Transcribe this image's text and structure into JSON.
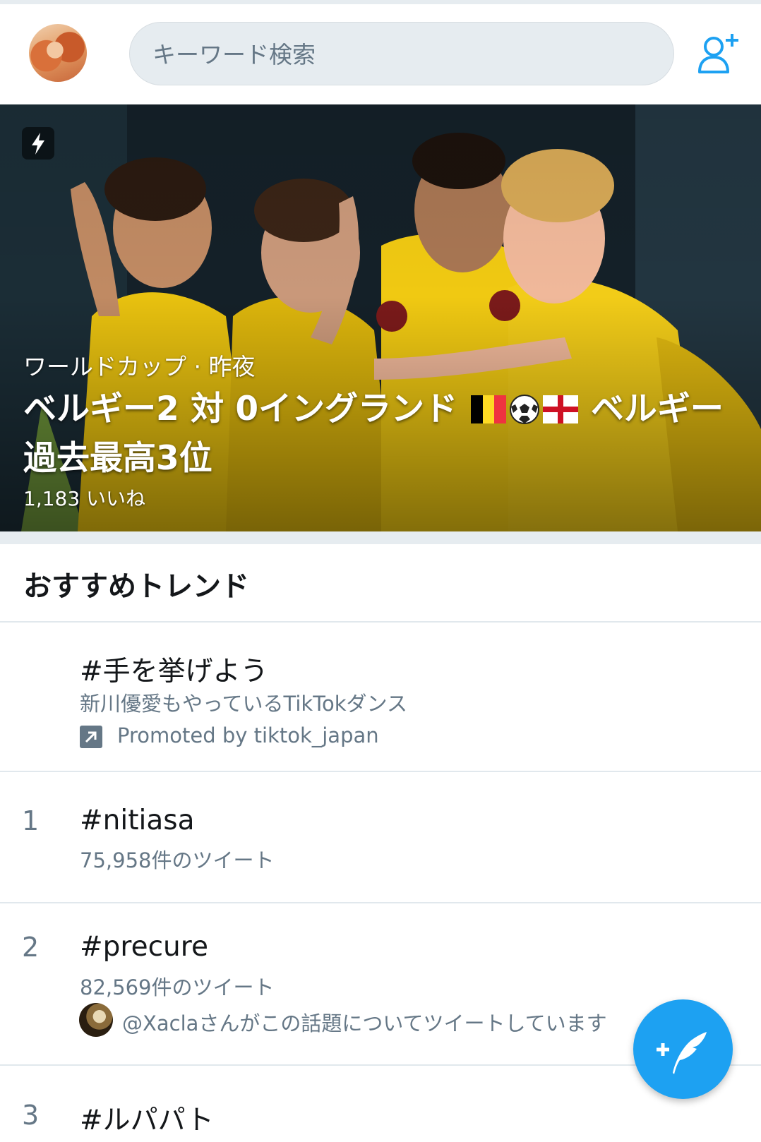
{
  "header": {
    "search_placeholder": "キーワード検索",
    "avatar_icon": "profile-avatar",
    "add_user_icon": "add-user-icon"
  },
  "hero": {
    "badge_icon": "lightning-bolt-icon",
    "meta": "ワールドカップ · 昨夜",
    "title_part1": "ベルギー2 対 0イングランド ",
    "title_part2": " ベルギー過去最高3位",
    "likes": "1,183 いいね"
  },
  "section": {
    "title": "おすすめトレンド"
  },
  "trends": [
    {
      "rank": "",
      "tag": "#手を挙げよう",
      "subtitle": "新川優愛もやっているTikTokダンス",
      "promoted": "Promoted by tiktok_japan"
    },
    {
      "rank": "1",
      "tag": "#nitiasa",
      "tweets": "75,958件のツイート"
    },
    {
      "rank": "2",
      "tag": "#precure",
      "tweets": "82,569件のツイート",
      "context": "@Xaclaさんがこの話題についてツイートしています"
    },
    {
      "rank": "3",
      "tag": "#ルパパト"
    }
  ],
  "colors": {
    "accent": "#1da1f2",
    "secondary_text": "#657786",
    "divider": "#e1e8ed",
    "search_bg": "#e6ecf0"
  },
  "fab": {
    "icon": "compose-tweet-icon"
  }
}
